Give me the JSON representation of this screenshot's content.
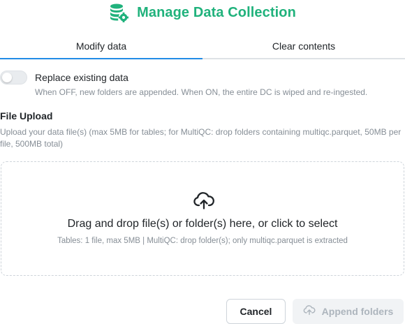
{
  "header": {
    "title": "Manage Data Collection",
    "icon": "database-gear-icon",
    "accent_color": "#20b27c"
  },
  "tabs": [
    {
      "label": "Modify data",
      "active": true
    },
    {
      "label": "Clear contents",
      "active": false
    }
  ],
  "replace_toggle": {
    "label": "Replace existing data",
    "checked": false,
    "description": "When OFF, new folders are appended. When ON, the entire DC is wiped and re-ingested."
  },
  "upload": {
    "title": "File Upload",
    "description": "Upload your data file(s) (max 5MB for tables; for MultiQC: drop folders containing multiqc.parquet, 50MB per file, 500MB total)",
    "dropzone": {
      "icon": "cloud-upload-icon",
      "main_text": "Drag and drop file(s) or folder(s) here, or click to select",
      "sub_text": "Tables: 1 file, max 5MB | MultiQC: drop folder(s); only multiqc.parquet is extracted"
    }
  },
  "actions": {
    "cancel_label": "Cancel",
    "append_label": "Append folders",
    "append_icon": "cloud-upload-icon",
    "append_disabled": true
  }
}
